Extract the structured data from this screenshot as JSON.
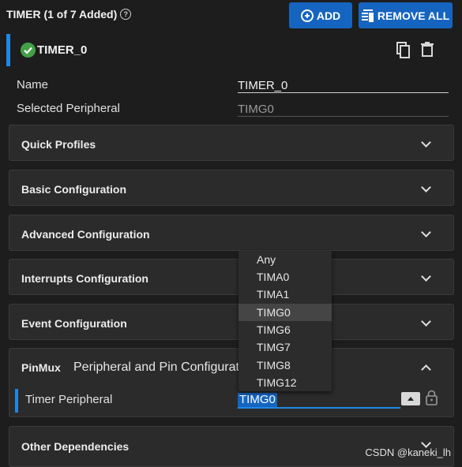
{
  "header": {
    "title": "TIMER (1 of 7 Added)",
    "help_icon": "help-circle-icon"
  },
  "toolbar": {
    "add_label": "ADD",
    "remove_all_label": "REMOVE ALL",
    "accent": "#1565c0"
  },
  "instance": {
    "name": "TIMER_0",
    "status_color": "#43a047",
    "copy_icon": "copy-icon",
    "delete_icon": "trash-icon"
  },
  "fields": {
    "name_label": "Name",
    "name_value": "TIMER_0",
    "peripheral_label": "Selected Peripheral",
    "peripheral_value": "TIMG0"
  },
  "panels": {
    "quick_profiles": "Quick Profiles",
    "basic": "Basic Configuration",
    "advanced": "Advanced Configuration",
    "interrupts": "Interrupts Configuration",
    "events": "Event Configuration",
    "pinmux": "PinMux",
    "pinmux_subtitle": "Peripheral and Pin Configuration",
    "other": "Other Dependencies"
  },
  "pinmux": {
    "timer_label": "Timer Peripheral",
    "timer_value": "TIMG0"
  },
  "dropdown": {
    "options": [
      "Any",
      "TIMA0",
      "TIMA1",
      "TIMG0",
      "TIMG6",
      "TIMG7",
      "TIMG8",
      "TIMG12"
    ],
    "selected": "TIMG0"
  },
  "watermark": "CSDN @kaneki_lh"
}
